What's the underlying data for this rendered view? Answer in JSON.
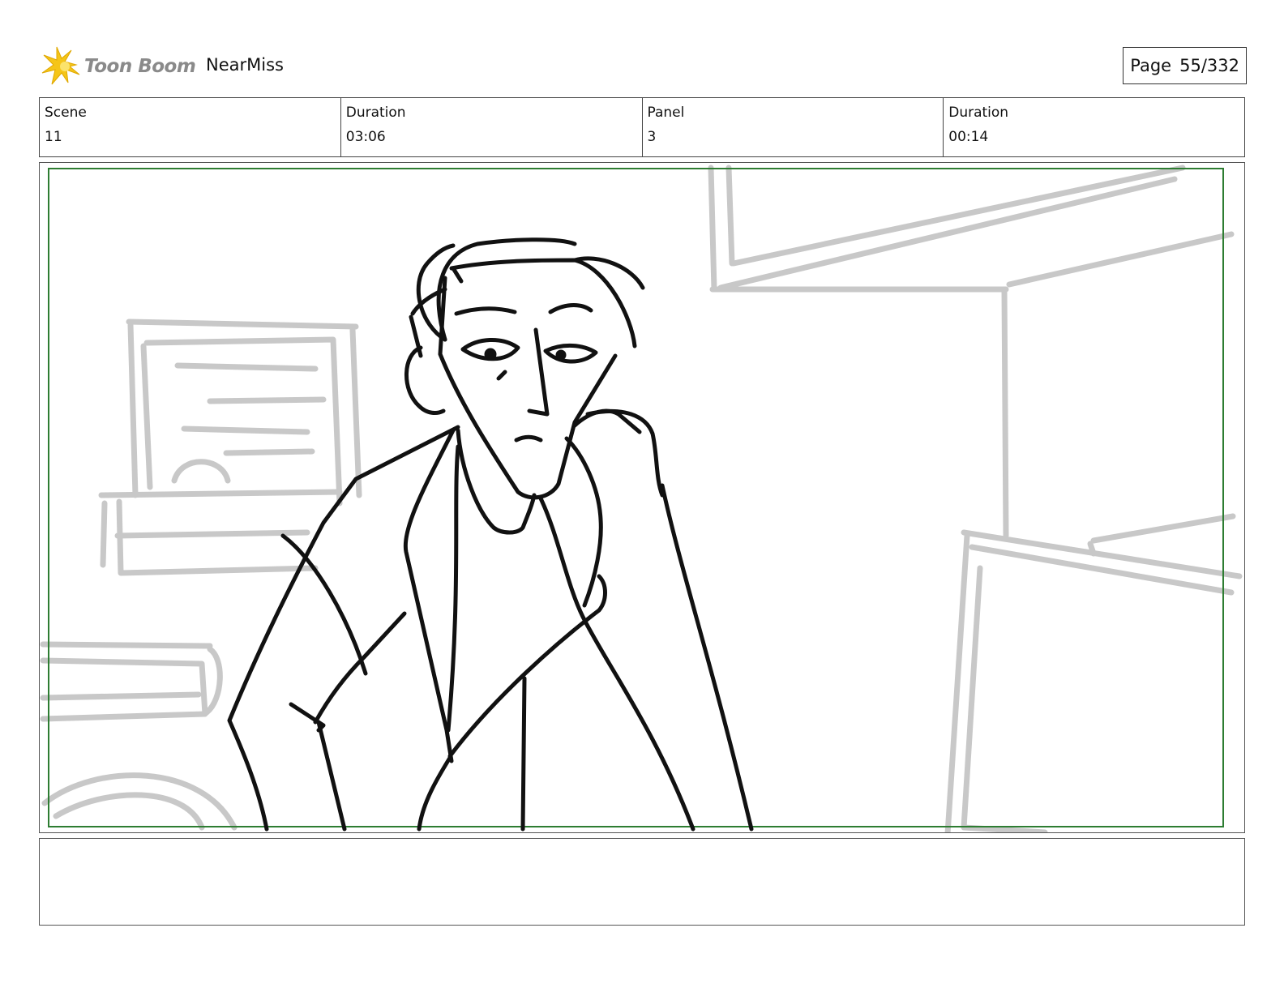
{
  "header": {
    "logo_text": "Toon Boom",
    "project_name": "NearMiss",
    "page_label": "Page",
    "page_number": "55/332"
  },
  "info": {
    "scene_label": "Scene",
    "scene_value": "11",
    "scene_duration_label": "Duration",
    "scene_duration_value": "03:06",
    "panel_label": "Panel",
    "panel_value": "3",
    "panel_duration_label": "Duration",
    "panel_duration_value": "00:14"
  },
  "notes": {
    "text": ""
  },
  "colors": {
    "logo_star": "#f5c518",
    "logo_text": "#8a8a8a",
    "safe_frame": "#2e7d32",
    "sketch_background": "#c8c8c8",
    "sketch_character": "#111111"
  }
}
